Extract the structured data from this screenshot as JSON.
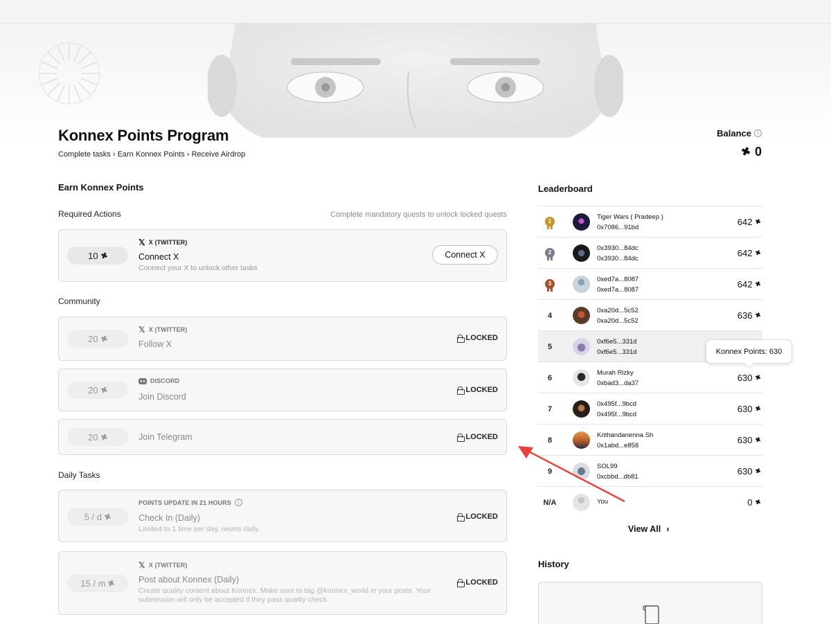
{
  "header": {
    "title": "Konnex Points Program",
    "subtitle": "Complete tasks › Earn Konnex Points › Receive Airdrop",
    "balance_label": "Balance",
    "balance_value": "0"
  },
  "earn": {
    "title": "Earn Konnex Points",
    "required_title": "Required Actions",
    "required_hint": "Complete mandatory quests to unlock locked quests",
    "community_title": "Community",
    "daily_title": "Daily Tasks",
    "locked_label": "LOCKED",
    "tasks": [
      {
        "points": "10",
        "platform": "X (TWITTER)",
        "name": "Connect X",
        "desc": "Connect your X to unlock other tasks",
        "button": "Connect X"
      },
      {
        "points": "20",
        "platform": "X (TWITTER)",
        "name": "Follow X"
      },
      {
        "points": "20",
        "platform": "DISCORD",
        "name": "Join Discord"
      },
      {
        "points": "20",
        "name": "Join Telegram"
      },
      {
        "points": "5 / d",
        "platform": "POINTS UPDATE IN 21 HOURS",
        "name": "Check In (Daily)",
        "desc": "Limited to 1 time per day, resets daily."
      },
      {
        "points": "15 / m",
        "platform": "X (TWITTER)",
        "name": "Post about Konnex (Daily)",
        "desc_line1": "Create quality content about Konnex. Make sure to tag @konnex_world in your posts. Your",
        "desc_line2": "submission will only be accepted if they pass quality check."
      }
    ]
  },
  "leaderboard": {
    "title": "Leaderboard",
    "rows": [
      {
        "rank": "1",
        "name": "Tiger Wars ( Pradeep )",
        "addr": "0x7086...91bd",
        "points": "642"
      },
      {
        "rank": "2",
        "name": "0x3930...84dc",
        "addr": "0x3930...84dc",
        "points": "642"
      },
      {
        "rank": "3",
        "name": "0xed7a...8087",
        "addr": "0xed7a...8087",
        "points": "642"
      },
      {
        "rank": "4",
        "name": "0xa20d...5c52",
        "addr": "0xa20d...5c52",
        "points": "636"
      },
      {
        "rank": "5",
        "name": "0xf6e5...331d",
        "addr": "0xf6e5...331d",
        "points": ""
      },
      {
        "rank": "6",
        "name": "Murah Rizky",
        "addr": "0xbad3...da37",
        "points": "630"
      },
      {
        "rank": "7",
        "name": "0x495f...9bcd",
        "addr": "0x495f...9bcd",
        "points": "630"
      },
      {
        "rank": "8",
        "name": "Krithandanenna Sh",
        "addr": "0x1abd...e858",
        "points": "630"
      },
      {
        "rank": "9",
        "name": "SOL99",
        "addr": "0xcbbd...db81",
        "points": "630"
      },
      {
        "rank": "N/A",
        "name": "You",
        "addr": "",
        "points": "0"
      }
    ],
    "tooltip": "Konnex Points: 630",
    "view_all": "View All"
  },
  "history": {
    "title": "History"
  },
  "colors": {
    "gold": "#c9962b",
    "silver": "#7c7c8a",
    "bronze": "#a4522e",
    "arrow": "#e8413a"
  }
}
